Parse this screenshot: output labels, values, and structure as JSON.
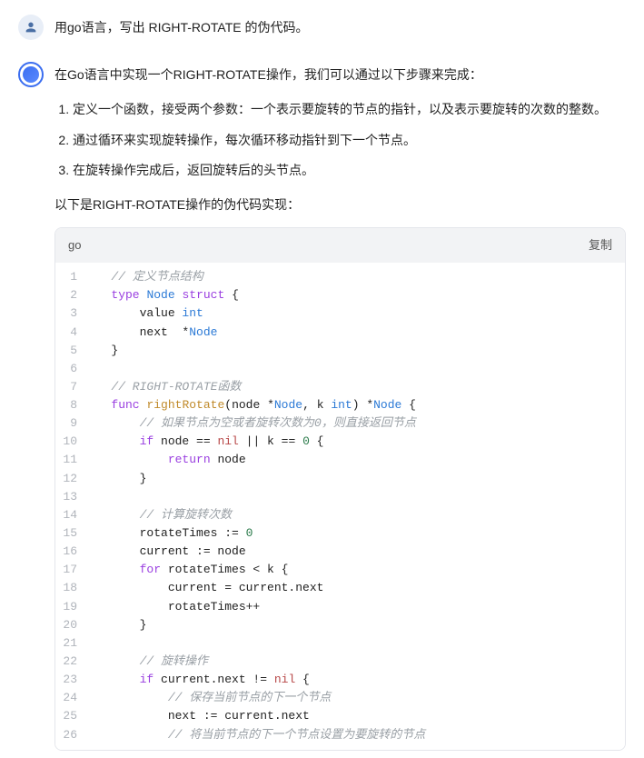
{
  "user": {
    "prompt": "用go语言，写出 RIGHT-ROTATE 的伪代码。"
  },
  "bot": {
    "intro": "在Go语言中实现一个RIGHT-ROTATE操作，我们可以通过以下步骤来完成：",
    "steps": [
      "定义一个函数，接受两个参数：一个表示要旋转的节点的指针，以及表示要旋转的次数的整数。",
      "通过循环来实现旋转操作，每次循环移动指针到下一个节点。",
      "在旋转操作完成后，返回旋转后的头节点。"
    ],
    "subhead": "以下是RIGHT-ROTATE操作的伪代码实现：",
    "code_lang": "go",
    "copy_label": "复制"
  },
  "code": {
    "lines": [
      {
        "n": 1,
        "segs": [
          {
            "t": "   ",
            "c": ""
          },
          {
            "t": "// 定义节点结构",
            "c": "c-c"
          }
        ]
      },
      {
        "n": 2,
        "segs": [
          {
            "t": "   ",
            "c": ""
          },
          {
            "t": "type",
            "c": "c-k"
          },
          {
            "t": " ",
            "c": ""
          },
          {
            "t": "Node",
            "c": "c-t"
          },
          {
            "t": " ",
            "c": ""
          },
          {
            "t": "struct",
            "c": "c-k"
          },
          {
            "t": " {",
            "c": ""
          }
        ]
      },
      {
        "n": 3,
        "segs": [
          {
            "t": "       value ",
            "c": ""
          },
          {
            "t": "int",
            "c": "c-t"
          }
        ]
      },
      {
        "n": 4,
        "segs": [
          {
            "t": "       next  *",
            "c": ""
          },
          {
            "t": "Node",
            "c": "c-t"
          }
        ]
      },
      {
        "n": 5,
        "segs": [
          {
            "t": "   }",
            "c": ""
          }
        ]
      },
      {
        "n": 6,
        "segs": [
          {
            "t": "",
            "c": ""
          }
        ]
      },
      {
        "n": 7,
        "segs": [
          {
            "t": "   ",
            "c": ""
          },
          {
            "t": "// RIGHT-ROTATE函数",
            "c": "c-c"
          }
        ]
      },
      {
        "n": 8,
        "segs": [
          {
            "t": "   ",
            "c": ""
          },
          {
            "t": "func",
            "c": "c-k"
          },
          {
            "t": " ",
            "c": ""
          },
          {
            "t": "rightRotate",
            "c": "c-f"
          },
          {
            "t": "(node *",
            "c": ""
          },
          {
            "t": "Node",
            "c": "c-t"
          },
          {
            "t": ", k ",
            "c": ""
          },
          {
            "t": "int",
            "c": "c-t"
          },
          {
            "t": ") *",
            "c": ""
          },
          {
            "t": "Node",
            "c": "c-t"
          },
          {
            "t": " {",
            "c": ""
          }
        ]
      },
      {
        "n": 9,
        "segs": [
          {
            "t": "       ",
            "c": ""
          },
          {
            "t": "// 如果节点为空或者旋转次数为0，则直接返回节点",
            "c": "c-c"
          }
        ]
      },
      {
        "n": 10,
        "segs": [
          {
            "t": "       ",
            "c": ""
          },
          {
            "t": "if",
            "c": "c-k"
          },
          {
            "t": " node == ",
            "c": ""
          },
          {
            "t": "nil",
            "c": "c-o"
          },
          {
            "t": " || k == ",
            "c": ""
          },
          {
            "t": "0",
            "c": "c-n"
          },
          {
            "t": " {",
            "c": ""
          }
        ]
      },
      {
        "n": 11,
        "segs": [
          {
            "t": "           ",
            "c": ""
          },
          {
            "t": "return",
            "c": "c-k"
          },
          {
            "t": " node",
            "c": ""
          }
        ]
      },
      {
        "n": 12,
        "segs": [
          {
            "t": "       }",
            "c": ""
          }
        ]
      },
      {
        "n": 13,
        "segs": [
          {
            "t": "",
            "c": ""
          }
        ]
      },
      {
        "n": 14,
        "segs": [
          {
            "t": "       ",
            "c": ""
          },
          {
            "t": "// 计算旋转次数",
            "c": "c-c"
          }
        ]
      },
      {
        "n": 15,
        "segs": [
          {
            "t": "       rotateTimes := ",
            "c": ""
          },
          {
            "t": "0",
            "c": "c-n"
          }
        ]
      },
      {
        "n": 16,
        "segs": [
          {
            "t": "       current := node",
            "c": ""
          }
        ]
      },
      {
        "n": 17,
        "segs": [
          {
            "t": "       ",
            "c": ""
          },
          {
            "t": "for",
            "c": "c-k"
          },
          {
            "t": " rotateTimes < k {",
            "c": ""
          }
        ]
      },
      {
        "n": 18,
        "segs": [
          {
            "t": "           current = current.next",
            "c": ""
          }
        ]
      },
      {
        "n": 19,
        "segs": [
          {
            "t": "           rotateTimes++",
            "c": ""
          }
        ]
      },
      {
        "n": 20,
        "segs": [
          {
            "t": "       }",
            "c": ""
          }
        ]
      },
      {
        "n": 21,
        "segs": [
          {
            "t": "",
            "c": ""
          }
        ]
      },
      {
        "n": 22,
        "segs": [
          {
            "t": "       ",
            "c": ""
          },
          {
            "t": "// 旋转操作",
            "c": "c-c"
          }
        ]
      },
      {
        "n": 23,
        "segs": [
          {
            "t": "       ",
            "c": ""
          },
          {
            "t": "if",
            "c": "c-k"
          },
          {
            "t": " current.next != ",
            "c": ""
          },
          {
            "t": "nil",
            "c": "c-o"
          },
          {
            "t": " {",
            "c": ""
          }
        ]
      },
      {
        "n": 24,
        "segs": [
          {
            "t": "           ",
            "c": ""
          },
          {
            "t": "// 保存当前节点的下一个节点",
            "c": "c-c"
          }
        ]
      },
      {
        "n": 25,
        "segs": [
          {
            "t": "           next := current.next",
            "c": ""
          }
        ]
      },
      {
        "n": 26,
        "segs": [
          {
            "t": "           ",
            "c": ""
          },
          {
            "t": "// 将当前节点的下一个节点设置为要旋转的节点",
            "c": "c-c"
          }
        ]
      }
    ]
  },
  "chart_data": {
    "type": "table",
    "note": "code listing, no chart"
  }
}
